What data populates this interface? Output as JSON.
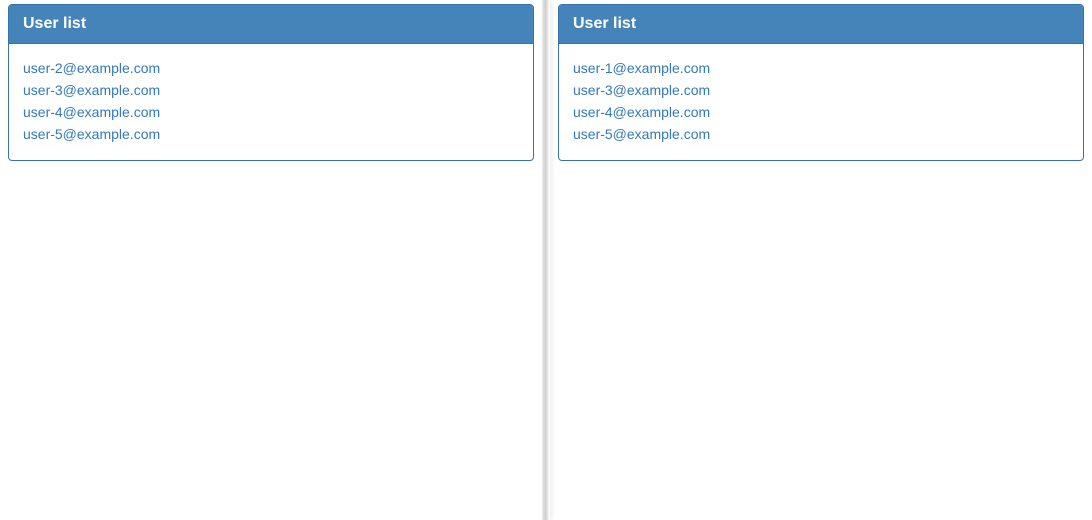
{
  "left": {
    "title": "User list",
    "users": [
      "user-2@example.com",
      "user-3@example.com",
      "user-4@example.com",
      "user-5@example.com"
    ]
  },
  "right": {
    "title": "User list",
    "users": [
      "user-1@example.com",
      "user-3@example.com",
      "user-4@example.com",
      "user-5@example.com"
    ]
  }
}
